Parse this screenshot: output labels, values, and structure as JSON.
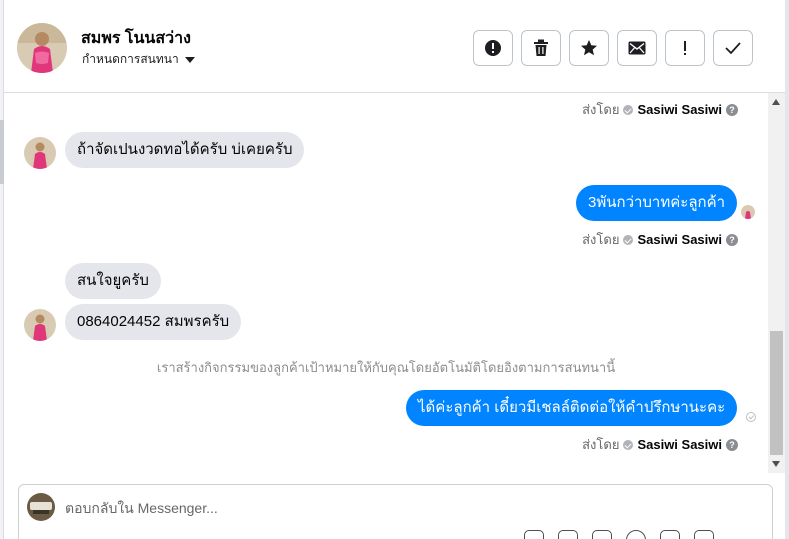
{
  "header": {
    "contact_name": "สมพร โนนสว่าง",
    "conversation_menu_label": "กำหนดการสนทนา",
    "tools": [
      {
        "name": "report-spam-button",
        "icon": "alert-circle-icon"
      },
      {
        "name": "delete-button",
        "icon": "trash-icon"
      },
      {
        "name": "star-button",
        "icon": "star-icon"
      },
      {
        "name": "mark-unread-button",
        "icon": "envelope-icon"
      },
      {
        "name": "follow-up-button",
        "icon": "exclamation-icon"
      },
      {
        "name": "mark-done-button",
        "icon": "checkmark-icon"
      }
    ]
  },
  "thread": {
    "sent_by_label": "ส่งโดย",
    "sender_name": "Sasiwi Sasiwi",
    "messages": [
      {
        "direction": "in",
        "text": "ถ้าจัดเปนงวดทอได้ครับ  บ่เคยครับ"
      },
      {
        "direction": "out",
        "text": "3พันกว่าบาทค่ะลูกค้า"
      },
      {
        "direction": "in",
        "text": "สนใจยูครับ"
      },
      {
        "direction": "in",
        "text": "0864024452  สมพรครับ"
      },
      {
        "direction": "out",
        "text": "ได้ค่ะลูกค้า เดี๋ยวมีเชลล์ติดต่อให้คำปรึกษานะคะ"
      }
    ],
    "system_note": "เราสร้างกิจกรรมของลูกค้าเป้าหมายให้กับคุณโดยอัตโนมัติโดยอิงตามการสนทนานี้"
  },
  "composer": {
    "placeholder": "ตอบกลับใน Messenger..."
  },
  "colors": {
    "outgoing_bubble": "#0084ff",
    "incoming_bubble": "#e4e6eb"
  }
}
